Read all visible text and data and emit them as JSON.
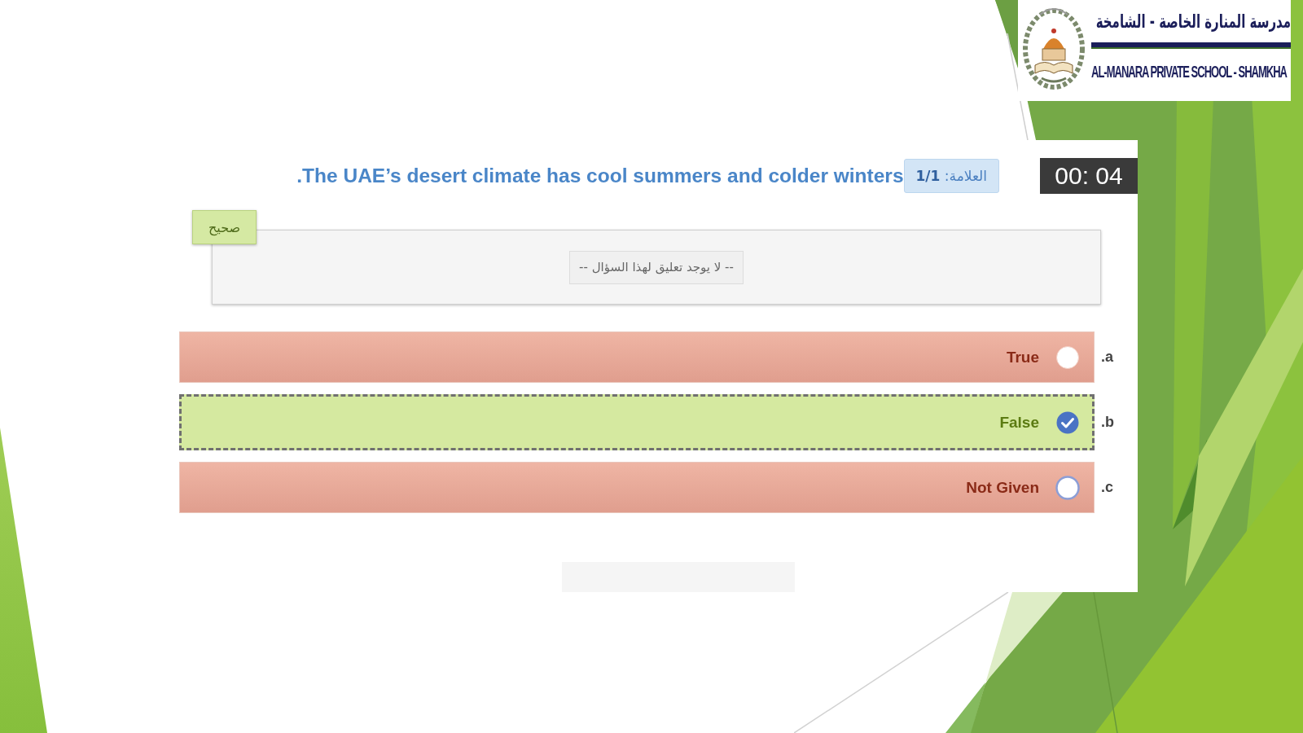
{
  "logo": {
    "name_arabic": "مدرسة المنارة الخاصة - الشامخة",
    "name_english": "AL-MANARA PRIVATE SCHOOL - SHAMKHA"
  },
  "question": {
    "text": ".The UAE’s desert climate has cool summers and colder winters",
    "mark": "العلامة: **1/1**",
    "timer": "00: 04"
  },
  "feedback": {
    "verdict": "صحيح",
    "comment": "-- لا يوجد تعليق لهذا السؤال --"
  },
  "options": [
    {
      "letter": ".a",
      "label": "True",
      "selected": false,
      "correct": false,
      "focused": false
    },
    {
      "letter": ".b",
      "label": "False",
      "selected": true,
      "correct": true,
      "focused": false
    },
    {
      "letter": ".c",
      "label": "Not Given",
      "selected": false,
      "correct": false,
      "focused": true
    }
  ]
}
